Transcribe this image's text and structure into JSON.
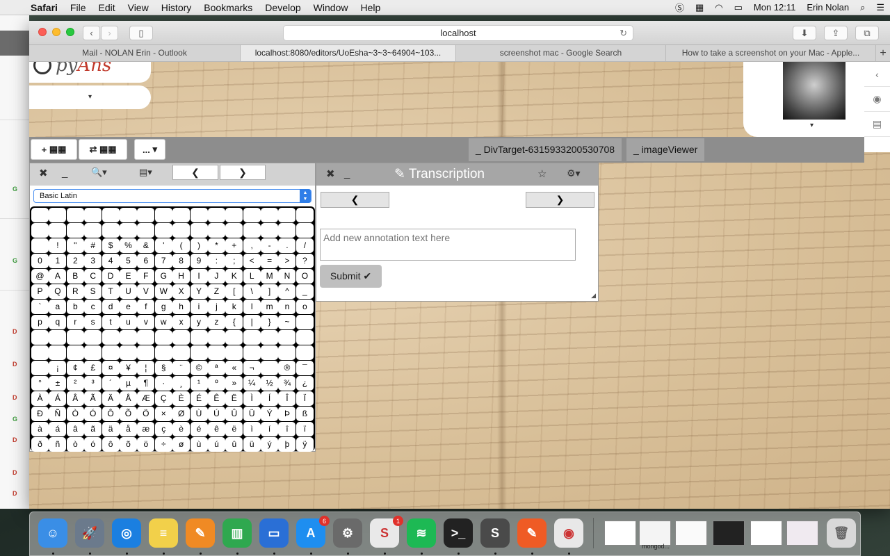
{
  "menubar": {
    "app": "Safari",
    "items": [
      "File",
      "Edit",
      "View",
      "History",
      "Bookmarks",
      "Develop",
      "Window",
      "Help"
    ],
    "clock": "Mon 12:11",
    "user": "Erin Nolan"
  },
  "browser": {
    "url": "localhost",
    "tabs": [
      {
        "label": "Mail - NOLAN Erin - Outlook",
        "active": false
      },
      {
        "label": "localhost:8080/editors/UoEsha~3~3~64904~103...",
        "active": true
      },
      {
        "label": "screenshot mac - Google Search",
        "active": false
      },
      {
        "label": "How to take a screenshot on your Mac - Apple...",
        "active": false
      }
    ],
    "new_tab": "+"
  },
  "app": {
    "logo": {
      "text_a": "py",
      "text_b": "Ans"
    },
    "toolbar": {
      "add_button": "+",
      "swap_button": "⇄",
      "more_button": "...",
      "caret": "▾"
    },
    "tab_pills": [
      "_ DivTarget-6315933200530708",
      "_ imageViewer"
    ]
  },
  "charpanel": {
    "close": "✖",
    "minimize": "_",
    "search": "🔍▾",
    "list": "▤▾",
    "prev": "❮",
    "next": "❯",
    "select": "Basic Latin",
    "rows": [
      [
        "",
        "",
        "",
        "",
        "",
        "",
        "",
        "",
        "",
        "",
        "",
        "",
        "",
        "",
        "",
        ""
      ],
      [
        "",
        "",
        "",
        "",
        "",
        "",
        "",
        "",
        "",
        "",
        "",
        "",
        "",
        "",
        "",
        ""
      ],
      [
        " ",
        "!",
        "\"",
        "#",
        "$",
        "%",
        "&",
        "'",
        "(",
        ")",
        "*",
        "+",
        ",",
        "-",
        ".",
        "/"
      ],
      [
        "0",
        "1",
        "2",
        "3",
        "4",
        "5",
        "6",
        "7",
        "8",
        "9",
        ":",
        ";",
        "<",
        "=",
        ">",
        "?"
      ],
      [
        "@",
        "A",
        "B",
        "C",
        "D",
        "E",
        "F",
        "G",
        "H",
        "I",
        "J",
        "K",
        "L",
        "M",
        "N",
        "O"
      ],
      [
        "P",
        "Q",
        "R",
        "S",
        "T",
        "U",
        "V",
        "W",
        "X",
        "Y",
        "Z",
        "[",
        "\\",
        "]",
        "^",
        "_"
      ],
      [
        "`",
        "a",
        "b",
        "c",
        "d",
        "e",
        "f",
        "g",
        "h",
        "i",
        "j",
        "k",
        "l",
        "m",
        "n",
        "o"
      ],
      [
        "p",
        "q",
        "r",
        "s",
        "t",
        "u",
        "v",
        "w",
        "x",
        "y",
        "z",
        "{",
        "|",
        "}",
        "~",
        ""
      ],
      [
        "",
        "",
        "",
        "",
        "",
        "",
        "",
        "",
        "",
        "",
        "",
        "",
        "",
        "",
        "",
        ""
      ],
      [
        "",
        "",
        "",
        "",
        "",
        "",
        "",
        "",
        "",
        "",
        "",
        "",
        "",
        "",
        "",
        ""
      ],
      [
        " ",
        "¡",
        "¢",
        "£",
        "¤",
        "¥",
        "¦",
        "§",
        "¨",
        "©",
        "ª",
        "«",
        "¬",
        "",
        "®",
        "¯"
      ],
      [
        "°",
        "±",
        "²",
        "³",
        "´",
        "µ",
        "¶",
        "·",
        "¸",
        "¹",
        "º",
        "»",
        "¼",
        "½",
        "¾",
        "¿"
      ],
      [
        "À",
        "Á",
        "Â",
        "Ã",
        "Ä",
        "Å",
        "Æ",
        "Ç",
        "È",
        "É",
        "Ê",
        "Ë",
        "Ì",
        "Í",
        "Î",
        "Ï"
      ],
      [
        "Ð",
        "Ñ",
        "Ò",
        "Ó",
        "Ô",
        "Õ",
        "Ö",
        "×",
        "Ø",
        "Ù",
        "Ú",
        "Û",
        "Ü",
        "Ý",
        "Þ",
        "ß"
      ],
      [
        "à",
        "á",
        "â",
        "ã",
        "ä",
        "å",
        "æ",
        "ç",
        "è",
        "é",
        "ê",
        "ë",
        "ì",
        "í",
        "î",
        "ï"
      ],
      [
        "ð",
        "ñ",
        "ò",
        "ó",
        "ô",
        "õ",
        "ö",
        "÷",
        "ø",
        "ù",
        "ú",
        "û",
        "ü",
        "ý",
        "þ",
        "ÿ"
      ]
    ]
  },
  "transcription": {
    "close": "✖",
    "minimize": "_",
    "title": "Transcription",
    "star": "☆",
    "gear": "⚙▾",
    "prev": "❮",
    "next": "❯",
    "placeholder": "Add new annotation text here",
    "submit": "Submit ✔"
  },
  "dock": {
    "apps": [
      {
        "name": "Finder",
        "color": "#3a8ee6",
        "glyph": "☺"
      },
      {
        "name": "Launchpad",
        "color": "#6b7a8c",
        "glyph": "🚀"
      },
      {
        "name": "Safari",
        "color": "#1b7fe0",
        "glyph": "◎"
      },
      {
        "name": "Notes",
        "color": "#f2d04a",
        "glyph": "≡"
      },
      {
        "name": "Pages",
        "color": "#f08a24",
        "glyph": "✎"
      },
      {
        "name": "Numbers",
        "color": "#2fa84f",
        "glyph": "▥"
      },
      {
        "name": "Keynote",
        "color": "#2a6fd6",
        "glyph": "▭"
      },
      {
        "name": "App Store",
        "color": "#1e8ef0",
        "glyph": "A",
        "badge": "6"
      },
      {
        "name": "System Preferences",
        "color": "#6a6a6a",
        "glyph": "⚙"
      },
      {
        "name": "Slack",
        "color": "#e9e9e9",
        "glyph": "S",
        "badge": "1"
      },
      {
        "name": "Spotify",
        "color": "#1db954",
        "glyph": "≋"
      },
      {
        "name": "Terminal",
        "color": "#222",
        "glyph": ">_"
      },
      {
        "name": "Sublime Text",
        "color": "#4a4a4a",
        "glyph": "S"
      },
      {
        "name": "Postman",
        "color": "#ef5b25",
        "glyph": "✎"
      },
      {
        "name": "Chrome",
        "color": "#e8e8e8",
        "glyph": "◉"
      }
    ],
    "window_label": "mongod...",
    "trash": "🗑"
  }
}
